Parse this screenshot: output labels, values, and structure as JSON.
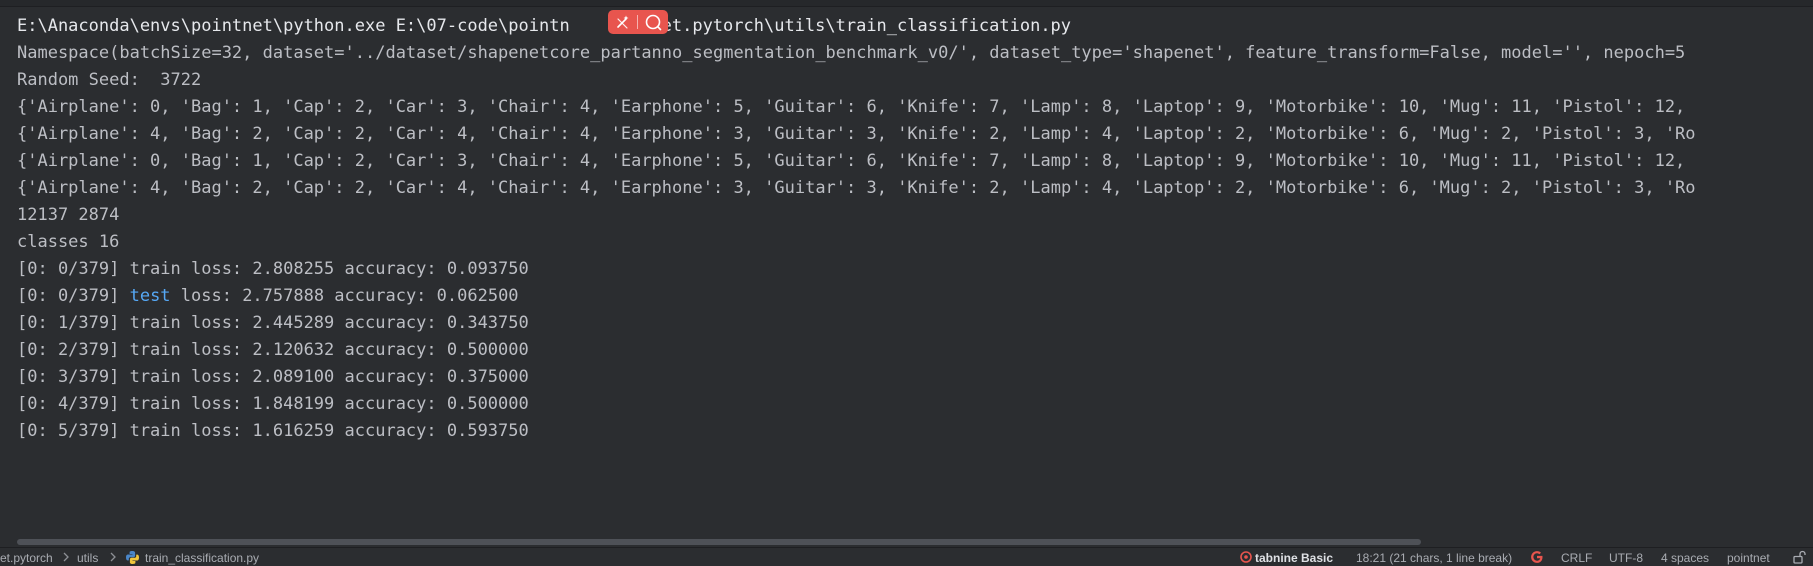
{
  "console": {
    "lines": [
      "E:\\Anaconda\\envs\\pointnet\\python.exe E:\\07-code\\pointn",
      "Namespace(batchSize=32, dataset='../dataset/shapenetcore_partanno_segmentation_benchmark_v0/', dataset_type='shapenet', feature_transform=False, model='', nepoch=5",
      "Random Seed:  3722",
      "{'Airplane': 0, 'Bag': 1, 'Cap': 2, 'Car': 3, 'Chair': 4, 'Earphone': 5, 'Guitar': 6, 'Knife': 7, 'Lamp': 8, 'Laptop': 9, 'Motorbike': 10, 'Mug': 11, 'Pistol': 12,",
      "{'Airplane': 4, 'Bag': 2, 'Cap': 2, 'Car': 4, 'Chair': 4, 'Earphone': 3, 'Guitar': 3, 'Knife': 2, 'Lamp': 4, 'Laptop': 2, 'Motorbike': 6, 'Mug': 2, 'Pistol': 3, 'Ro",
      "{'Airplane': 0, 'Bag': 1, 'Cap': 2, 'Car': 3, 'Chair': 4, 'Earphone': 5, 'Guitar': 6, 'Knife': 7, 'Lamp': 8, 'Laptop': 9, 'Motorbike': 10, 'Mug': 11, 'Pistol': 12,",
      "{'Airplane': 4, 'Bag': 2, 'Cap': 2, 'Car': 4, 'Chair': 4, 'Earphone': 3, 'Guitar': 3, 'Knife': 2, 'Lamp': 4, 'Laptop': 2, 'Motorbike': 6, 'Mug': 2, 'Pistol': 3, 'Ro",
      "12137 2874",
      "classes 16",
      "[0: 0/379] train loss: 2.808255 accuracy: 0.093750"
    ],
    "command_tail": "intnet.pytorch\\utils\\train_classification.py",
    "test_line": {
      "prefix": "[0: 0/379] ",
      "keyword": "test",
      "rest": " loss: 2.757888 accuracy: 0.062500"
    },
    "train_lines": [
      "[0: 1/379] train loss: 2.445289 accuracy: 0.343750",
      "[0: 2/379] train loss: 2.120632 accuracy: 0.500000",
      "[0: 3/379] train loss: 2.089100 accuracy: 0.375000",
      "[0: 4/379] train loss: 1.848199 accuracy: 0.500000",
      "[0: 5/379] train loss: 1.616259 accuracy: 0.593750"
    ],
    "colors": {
      "background": "#2b2d30",
      "text": "#bcbec4",
      "keyword": "#56a8f5",
      "toolbar_accent": "#e8554e"
    }
  },
  "floating_toolbar": {
    "icons": [
      "magic-wand-icon",
      "search-icon"
    ]
  },
  "statusbar": {
    "breadcrumb": [
      "et.pytorch",
      "utils",
      "train_classification.py"
    ],
    "file_icon": "python-file-icon",
    "tabnine_brand": "tabnine",
    "tabnine_plan": "Basic",
    "cursor_position": "18:21 (21 chars, 1 line break)",
    "google_icon": "google-icon",
    "line_separator": "CRLF",
    "encoding": "UTF-8",
    "indent": "4 spaces",
    "interpreter": "pointnet",
    "lock_icon": "unlock-icon"
  }
}
